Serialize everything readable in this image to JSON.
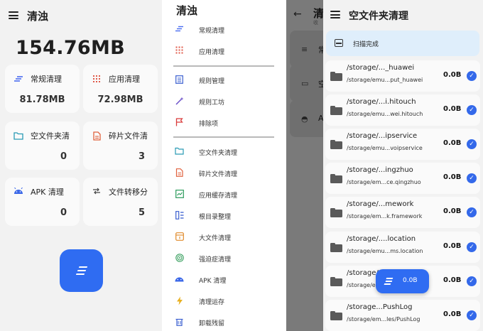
{
  "main": {
    "title": "清浊",
    "total_size": "154.76MB",
    "cards": [
      {
        "label": "常规清理",
        "value": "81.78MB",
        "icon": "lines-icon",
        "color": "#4a6cf0"
      },
      {
        "label": "应用清理",
        "value": "72.98MB",
        "icon": "grid-icon",
        "color": "#e05a4a"
      },
      {
        "label": "空文件夹清",
        "value": "0",
        "icon": "folder-icon",
        "color": "#2a9bb5"
      },
      {
        "label": "碎片文件清",
        "value": "3",
        "icon": "file-icon",
        "color": "#e0603c"
      },
      {
        "label": "APK 清理",
        "value": "0",
        "icon": "android-icon",
        "color": "#3a67e8"
      },
      {
        "label": "文件转移分",
        "value": "5",
        "icon": "transfer-icon",
        "color": "#444444"
      }
    ]
  },
  "drawer": {
    "title": "清浊",
    "items": [
      {
        "label": "常规清理",
        "icon": "lines-icon",
        "color": "#4a6cf0"
      },
      {
        "label": "应用清理",
        "icon": "grid-icon",
        "color": "#e05a4a"
      },
      {
        "label": "规则管理",
        "icon": "list-icon",
        "color": "#3a5fd0"
      },
      {
        "label": "规则工坊",
        "icon": "wand-icon",
        "color": "#6a4fc8"
      },
      {
        "label": "排除项",
        "icon": "flag-icon",
        "color": "#d93a3a"
      },
      {
        "label": "空文件夹清理",
        "icon": "folder-icon",
        "color": "#2a9bb5"
      },
      {
        "label": "碎片文件清理",
        "icon": "file-icon",
        "color": "#e0603c"
      },
      {
        "label": "应用缓存清理",
        "icon": "chart-icon",
        "color": "#2a9a5a"
      },
      {
        "label": "根目录整理",
        "icon": "columns-icon",
        "color": "#3a5fd0"
      },
      {
        "label": "大文件清理",
        "icon": "box-icon",
        "color": "#e08a2a"
      },
      {
        "label": "强迫症清理",
        "icon": "target-icon",
        "color": "#3aa060"
      },
      {
        "label": "APK 清理",
        "icon": "android-icon",
        "color": "#3a67e8"
      },
      {
        "label": "清理运存",
        "icon": "bolt-icon",
        "color": "#e8b020"
      },
      {
        "label": "卸载残留",
        "icon": "trash-icon",
        "color": "#3a5fd0"
      }
    ]
  },
  "background": {
    "title": "清",
    "subtitle": "收",
    "row_labels": [
      "常",
      "空",
      "A"
    ]
  },
  "empty_folders": {
    "title": "空文件夹清理",
    "banner": "扫描完成",
    "rows": [
      {
        "path": "/storage/..._huawei",
        "sub": "/storage/emu...put_huawei",
        "size": "0.0B"
      },
      {
        "path": "/storage/...i.hitouch",
        "sub": "/storage/emu...wei.hitouch",
        "size": "0.0B"
      },
      {
        "path": "/storage/...ipservice",
        "sub": "/storage/emu...voipservice",
        "size": "0.0B"
      },
      {
        "path": "/storage/...ingzhuo",
        "sub": "/storage/em...ce.qingzhuo",
        "size": "0.0B"
      },
      {
        "path": "/storage/...mework",
        "sub": "/storage/em...k.framework",
        "size": "0.0B"
      },
      {
        "path": "/storage/....location",
        "sub": "/storage/emu...ms.location",
        "size": "0.0B"
      },
      {
        "path": "/storage/",
        "sub": "/storage/e",
        "size": "0.0B"
      },
      {
        "path": "/storage...PushLog",
        "sub": "/storage/em...les/PushLog",
        "size": "0.0B"
      }
    ],
    "fab_label": "0.0B",
    "accent": "#2f6cf2"
  }
}
